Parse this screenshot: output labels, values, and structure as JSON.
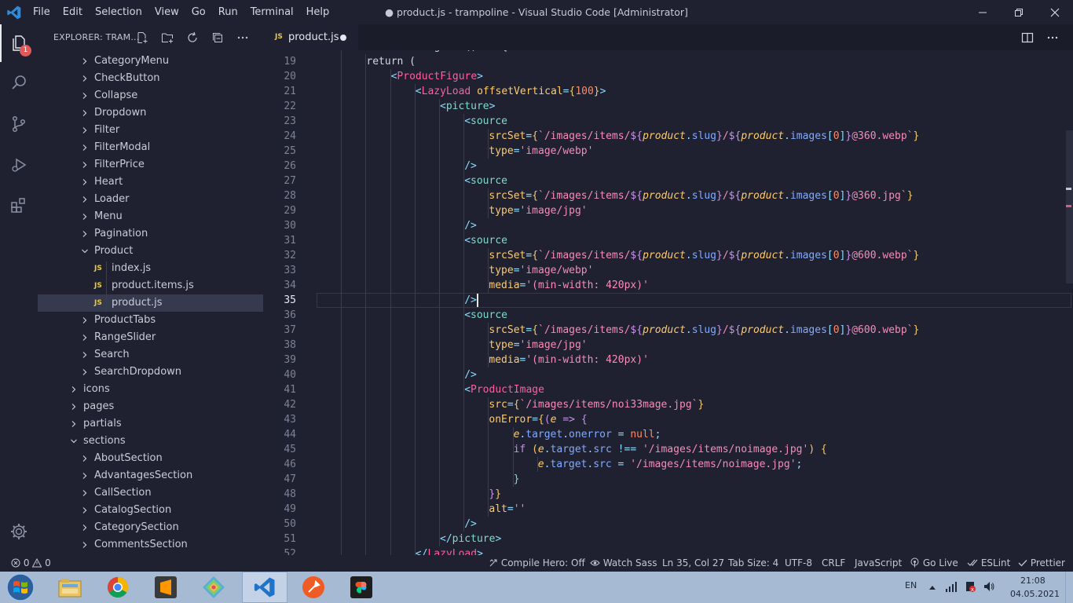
{
  "titlebar": {
    "menus": [
      "File",
      "Edit",
      "Selection",
      "View",
      "Go",
      "Run",
      "Terminal",
      "Help"
    ],
    "window_title": "● product.js - trampoline - Visual Studio Code [Administrator]"
  },
  "activity": {
    "explorer_badge": "1"
  },
  "sidebar": {
    "title": "EXPLORER: TRAM...",
    "tree": [
      {
        "label": "CategoryMenu",
        "kind": "folder",
        "level": 1,
        "open": false
      },
      {
        "label": "CheckButton",
        "kind": "folder",
        "level": 1,
        "open": false
      },
      {
        "label": "Collapse",
        "kind": "folder",
        "level": 1,
        "open": false
      },
      {
        "label": "Dropdown",
        "kind": "folder",
        "level": 1,
        "open": false
      },
      {
        "label": "Filter",
        "kind": "folder",
        "level": 1,
        "open": false
      },
      {
        "label": "FilterModal",
        "kind": "folder",
        "level": 1,
        "open": false
      },
      {
        "label": "FilterPrice",
        "kind": "folder",
        "level": 1,
        "open": false
      },
      {
        "label": "Heart",
        "kind": "folder",
        "level": 1,
        "open": false
      },
      {
        "label": "Loader",
        "kind": "folder",
        "level": 1,
        "open": false
      },
      {
        "label": "Menu",
        "kind": "folder",
        "level": 1,
        "open": false
      },
      {
        "label": "Pagination",
        "kind": "folder",
        "level": 1,
        "open": false
      },
      {
        "label": "Product",
        "kind": "folder",
        "level": 1,
        "open": true
      },
      {
        "label": "index.js",
        "kind": "file",
        "level": 2
      },
      {
        "label": "product.items.js",
        "kind": "file",
        "level": 2
      },
      {
        "label": "product.js",
        "kind": "file",
        "level": 2,
        "selected": true
      },
      {
        "label": "ProductTabs",
        "kind": "folder",
        "level": 1,
        "open": false
      },
      {
        "label": "RangeSlider",
        "kind": "folder",
        "level": 1,
        "open": false
      },
      {
        "label": "Search",
        "kind": "folder",
        "level": 1,
        "open": false
      },
      {
        "label": "SearchDropdown",
        "kind": "folder",
        "level": 1,
        "open": false
      },
      {
        "label": "icons",
        "kind": "folder",
        "level": 0,
        "open": false
      },
      {
        "label": "pages",
        "kind": "folder",
        "level": 0,
        "open": false
      },
      {
        "label": "partials",
        "kind": "folder",
        "level": 0,
        "open": false
      },
      {
        "label": "sections",
        "kind": "folder",
        "level": 0,
        "open": true
      },
      {
        "label": "AboutSection",
        "kind": "folder",
        "level": 1,
        "open": false
      },
      {
        "label": "AdvantagesSection",
        "kind": "folder",
        "level": 1,
        "open": false
      },
      {
        "label": "CallSection",
        "kind": "folder",
        "level": 1,
        "open": false
      },
      {
        "label": "CatalogSection",
        "kind": "folder",
        "level": 1,
        "open": false
      },
      {
        "label": "CategorySection",
        "kind": "folder",
        "level": 1,
        "open": false
      },
      {
        "label": "CommentsSection",
        "kind": "folder",
        "level": 1,
        "open": false
      }
    ]
  },
  "editor": {
    "tab": {
      "icon": "JS",
      "label": "product.js",
      "dirty": true
    },
    "current_line": 35,
    "lines": [
      {
        "n": 18,
        "indent": 1,
        "t": [
          [
            "const renderImage = () => {",
            "tk-plain"
          ]
        ]
      },
      {
        "n": 19,
        "indent": 2,
        "t": [
          [
            "return",
            "tk-plain"
          ],
          [
            " (",
            "tk-plain"
          ]
        ]
      },
      {
        "n": 20,
        "indent": 3,
        "t": [
          [
            "<",
            "tk-ang"
          ],
          [
            "ProductFigure",
            "tk-tag"
          ],
          [
            ">",
            "tk-ang"
          ]
        ]
      },
      {
        "n": 21,
        "indent": 4,
        "t": [
          [
            "<",
            "tk-ang"
          ],
          [
            "LazyLoad",
            "tk-tag"
          ],
          [
            " ",
            "tk-plain"
          ],
          [
            "offsetVertical",
            "tk-attr"
          ],
          [
            "=",
            "tk-ang"
          ],
          [
            "{",
            "tk-brace"
          ],
          [
            "100",
            "tk-num"
          ],
          [
            "}",
            "tk-brace"
          ],
          [
            ">",
            "tk-ang"
          ]
        ]
      },
      {
        "n": 22,
        "indent": 5,
        "t": [
          [
            "<",
            "tk-ang"
          ],
          [
            "picture",
            "tk-tagb"
          ],
          [
            ">",
            "tk-ang"
          ]
        ]
      },
      {
        "n": 23,
        "indent": 6,
        "t": [
          [
            "<",
            "tk-ang"
          ],
          [
            "source",
            "tk-tagb"
          ]
        ]
      },
      {
        "n": 24,
        "indent": 7,
        "t": [
          [
            "srcSet",
            "tk-attr"
          ],
          [
            "=",
            "tk-ang"
          ],
          [
            "{",
            "tk-brace"
          ],
          [
            "`/images/items/",
            "tk-str"
          ],
          [
            "${",
            "tk-tmpl"
          ],
          [
            "product",
            "tk-var"
          ],
          [
            ".",
            "tk-ang"
          ],
          [
            "slug",
            "tk-prop"
          ],
          [
            "}",
            "tk-tmpl"
          ],
          [
            "/",
            "tk-str"
          ],
          [
            "${",
            "tk-tmpl"
          ],
          [
            "product",
            "tk-var"
          ],
          [
            ".",
            "tk-ang"
          ],
          [
            "images",
            "tk-prop"
          ],
          [
            "[",
            "tk-ang"
          ],
          [
            "0",
            "tk-num"
          ],
          [
            "]",
            "tk-ang"
          ],
          [
            "}",
            "tk-tmpl"
          ],
          [
            "@360.webp`",
            "tk-str"
          ],
          [
            "}",
            "tk-brace"
          ]
        ]
      },
      {
        "n": 25,
        "indent": 7,
        "t": [
          [
            "type",
            "tk-attr"
          ],
          [
            "=",
            "tk-ang"
          ],
          [
            "'image/webp'",
            "tk-str"
          ]
        ]
      },
      {
        "n": 26,
        "indent": 6,
        "t": [
          [
            "/>",
            "tk-ang"
          ]
        ]
      },
      {
        "n": 27,
        "indent": 6,
        "t": [
          [
            "<",
            "tk-ang"
          ],
          [
            "source",
            "tk-tagb"
          ]
        ]
      },
      {
        "n": 28,
        "indent": 7,
        "t": [
          [
            "srcSet",
            "tk-attr"
          ],
          [
            "=",
            "tk-ang"
          ],
          [
            "{",
            "tk-brace"
          ],
          [
            "`/images/items/",
            "tk-str"
          ],
          [
            "${",
            "tk-tmpl"
          ],
          [
            "product",
            "tk-var"
          ],
          [
            ".",
            "tk-ang"
          ],
          [
            "slug",
            "tk-prop"
          ],
          [
            "}",
            "tk-tmpl"
          ],
          [
            "/",
            "tk-str"
          ],
          [
            "${",
            "tk-tmpl"
          ],
          [
            "product",
            "tk-var"
          ],
          [
            ".",
            "tk-ang"
          ],
          [
            "images",
            "tk-prop"
          ],
          [
            "[",
            "tk-ang"
          ],
          [
            "0",
            "tk-num"
          ],
          [
            "]",
            "tk-ang"
          ],
          [
            "}",
            "tk-tmpl"
          ],
          [
            "@360.jpg`",
            "tk-str"
          ],
          [
            "}",
            "tk-brace"
          ]
        ]
      },
      {
        "n": 29,
        "indent": 7,
        "t": [
          [
            "type",
            "tk-attr"
          ],
          [
            "=",
            "tk-ang"
          ],
          [
            "'image/jpg'",
            "tk-str"
          ]
        ]
      },
      {
        "n": 30,
        "indent": 6,
        "t": [
          [
            "/>",
            "tk-ang"
          ]
        ]
      },
      {
        "n": 31,
        "indent": 6,
        "t": [
          [
            "<",
            "tk-ang"
          ],
          [
            "source",
            "tk-tagb"
          ]
        ]
      },
      {
        "n": 32,
        "indent": 7,
        "t": [
          [
            "srcSet",
            "tk-attr"
          ],
          [
            "=",
            "tk-ang"
          ],
          [
            "{",
            "tk-brace"
          ],
          [
            "`/images/items/",
            "tk-str"
          ],
          [
            "${",
            "tk-tmpl"
          ],
          [
            "product",
            "tk-var"
          ],
          [
            ".",
            "tk-ang"
          ],
          [
            "slug",
            "tk-prop"
          ],
          [
            "}",
            "tk-tmpl"
          ],
          [
            "/",
            "tk-str"
          ],
          [
            "${",
            "tk-tmpl"
          ],
          [
            "product",
            "tk-var"
          ],
          [
            ".",
            "tk-ang"
          ],
          [
            "images",
            "tk-prop"
          ],
          [
            "[",
            "tk-ang"
          ],
          [
            "0",
            "tk-num"
          ],
          [
            "]",
            "tk-ang"
          ],
          [
            "}",
            "tk-tmpl"
          ],
          [
            "@600.webp`",
            "tk-str"
          ],
          [
            "}",
            "tk-brace"
          ]
        ]
      },
      {
        "n": 33,
        "indent": 7,
        "t": [
          [
            "type",
            "tk-attr"
          ],
          [
            "=",
            "tk-ang"
          ],
          [
            "'image/webp'",
            "tk-str"
          ]
        ]
      },
      {
        "n": 34,
        "indent": 7,
        "t": [
          [
            "media",
            "tk-attr"
          ],
          [
            "=",
            "tk-ang"
          ],
          [
            "'(min-width: 420px)'",
            "tk-str"
          ]
        ]
      },
      {
        "n": 35,
        "indent": 6,
        "t": [
          [
            "/>",
            "tk-ang"
          ]
        ]
      },
      {
        "n": 36,
        "indent": 6,
        "t": [
          [
            "<",
            "tk-ang"
          ],
          [
            "source",
            "tk-tagb"
          ]
        ]
      },
      {
        "n": 37,
        "indent": 7,
        "t": [
          [
            "srcSet",
            "tk-attr"
          ],
          [
            "=",
            "tk-ang"
          ],
          [
            "{",
            "tk-brace"
          ],
          [
            "`/images/items/",
            "tk-str"
          ],
          [
            "${",
            "tk-tmpl"
          ],
          [
            "product",
            "tk-var"
          ],
          [
            ".",
            "tk-ang"
          ],
          [
            "slug",
            "tk-prop"
          ],
          [
            "}",
            "tk-tmpl"
          ],
          [
            "/",
            "tk-str"
          ],
          [
            "${",
            "tk-tmpl"
          ],
          [
            "product",
            "tk-var"
          ],
          [
            ".",
            "tk-ang"
          ],
          [
            "images",
            "tk-prop"
          ],
          [
            "[",
            "tk-ang"
          ],
          [
            "0",
            "tk-num"
          ],
          [
            "]",
            "tk-ang"
          ],
          [
            "}",
            "tk-tmpl"
          ],
          [
            "@600.webp`",
            "tk-str"
          ],
          [
            "}",
            "tk-brace"
          ]
        ]
      },
      {
        "n": 38,
        "indent": 7,
        "t": [
          [
            "type",
            "tk-attr"
          ],
          [
            "=",
            "tk-ang"
          ],
          [
            "'image/jpg'",
            "tk-str"
          ]
        ]
      },
      {
        "n": 39,
        "indent": 7,
        "t": [
          [
            "media",
            "tk-attr"
          ],
          [
            "=",
            "tk-ang"
          ],
          [
            "'(min-width: 420px)'",
            "tk-str"
          ]
        ]
      },
      {
        "n": 40,
        "indent": 6,
        "t": [
          [
            "/>",
            "tk-ang"
          ]
        ]
      },
      {
        "n": 41,
        "indent": 6,
        "t": [
          [
            "<",
            "tk-ang"
          ],
          [
            "ProductImage",
            "tk-tag"
          ]
        ]
      },
      {
        "n": 42,
        "indent": 7,
        "t": [
          [
            "src",
            "tk-attr"
          ],
          [
            "=",
            "tk-ang"
          ],
          [
            "{",
            "tk-brace"
          ],
          [
            "`/images/items/noi33mage.jpg`",
            "tk-str"
          ],
          [
            "}",
            "tk-brace"
          ]
        ]
      },
      {
        "n": 43,
        "indent": 7,
        "t": [
          [
            "onError",
            "tk-attr"
          ],
          [
            "=",
            "tk-ang"
          ],
          [
            "{",
            "tk-brace"
          ],
          [
            "(",
            "tk-kw"
          ],
          [
            "e",
            "tk-var"
          ],
          [
            " => ",
            "tk-kw"
          ],
          [
            "{",
            "tk-kw"
          ]
        ]
      },
      {
        "n": 44,
        "indent": 8,
        "t": [
          [
            "e",
            "tk-var"
          ],
          [
            ".",
            "tk-ang"
          ],
          [
            "target",
            "tk-prop"
          ],
          [
            ".",
            "tk-ang"
          ],
          [
            "onerror",
            "tk-prop"
          ],
          [
            " = ",
            "tk-ang"
          ],
          [
            "null",
            "tk-num"
          ],
          [
            ";",
            "tk-ang"
          ]
        ]
      },
      {
        "n": 45,
        "indent": 8,
        "t": [
          [
            "if",
            "tk-kw"
          ],
          [
            " (",
            "tk-brace"
          ],
          [
            "e",
            "tk-var"
          ],
          [
            ".",
            "tk-ang"
          ],
          [
            "target",
            "tk-prop"
          ],
          [
            ".",
            "tk-ang"
          ],
          [
            "src",
            "tk-prop"
          ],
          [
            " !== ",
            "tk-ang"
          ],
          [
            "'/images/items/noimage.jpg'",
            "tk-str"
          ],
          [
            ") {",
            "tk-brace"
          ]
        ]
      },
      {
        "n": 46,
        "indent": 9,
        "t": [
          [
            "e",
            "tk-var"
          ],
          [
            ".",
            "tk-ang"
          ],
          [
            "target",
            "tk-prop"
          ],
          [
            ".",
            "tk-ang"
          ],
          [
            "src",
            "tk-prop"
          ],
          [
            " = ",
            "tk-ang"
          ],
          [
            "'/images/items/noimage.jpg'",
            "tk-str"
          ],
          [
            ";",
            "tk-ang"
          ]
        ]
      },
      {
        "n": 47,
        "indent": 8,
        "t": [
          [
            "}",
            "tk-tagb"
          ]
        ]
      },
      {
        "n": 48,
        "indent": 7,
        "t": [
          [
            "}",
            "tk-kw"
          ],
          [
            "}",
            "tk-brace"
          ]
        ]
      },
      {
        "n": 49,
        "indent": 7,
        "t": [
          [
            "alt",
            "tk-attr"
          ],
          [
            "=",
            "tk-ang"
          ],
          [
            "''",
            "tk-str"
          ]
        ]
      },
      {
        "n": 50,
        "indent": 6,
        "t": [
          [
            "/>",
            "tk-ang"
          ]
        ]
      },
      {
        "n": 51,
        "indent": 5,
        "t": [
          [
            "</",
            "tk-ang"
          ],
          [
            "picture",
            "tk-tagb"
          ],
          [
            ">",
            "tk-ang"
          ]
        ]
      },
      {
        "n": 52,
        "indent": 4,
        "t": [
          [
            "</",
            "tk-ang"
          ],
          [
            "LazyLoad",
            "tk-tag"
          ],
          [
            ">",
            "tk-ang"
          ]
        ]
      }
    ]
  },
  "status": {
    "problems": "0",
    "warnings": "0",
    "compile_hero": "Compile Hero: Off",
    "watch_sass": "Watch Sass",
    "position": "Ln 35, Col 27",
    "tab_size": "Tab Size: 4",
    "encoding": "UTF-8",
    "eol": "CRLF",
    "language": "JavaScript",
    "go_live": "Go Live",
    "eslint": "ESLint",
    "prettier": "Prettier"
  },
  "taskbar": {
    "apps": [
      "start-orb",
      "file-explorer",
      "chrome",
      "sublime-text",
      "git-kraken",
      "vscode",
      "postman",
      "figma"
    ],
    "active_app": "vscode",
    "lang": "EN",
    "time": "21:08",
    "date": "04.05.2021"
  },
  "colors": {
    "background": "#1f2130",
    "selection": "#363a4f",
    "accent_tag": "#ff5f9e",
    "string": "#f78cb9",
    "taskbar": "#a7bad3"
  }
}
